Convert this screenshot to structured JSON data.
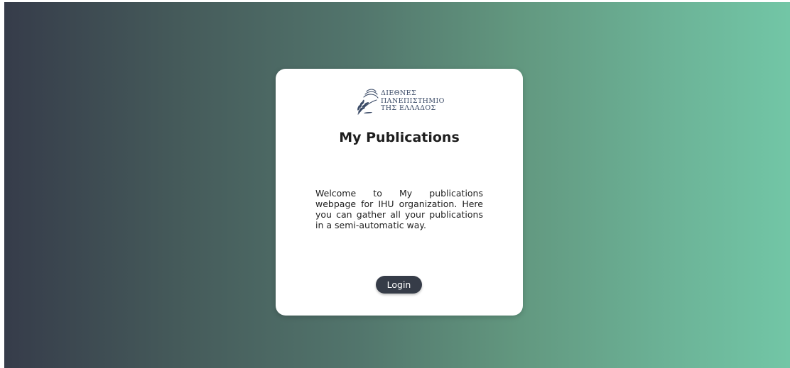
{
  "logo": {
    "icon": "olive-branch-wave-logo",
    "lines": [
      "ΔΙΕΘΝΕΣ",
      "ΠΑΝΕΠΙΣΤΗΜΙΟ",
      "ΤΗΣ ΕΛΛΑΔΟΣ"
    ]
  },
  "card": {
    "title": "My Publications",
    "welcome": "Welcome to My publications webpage for IHU organization. Here you can gather all your publications in a semi-automatic way.",
    "login_label": "Login"
  },
  "colors": {
    "gradient_start": "#363c4a",
    "gradient_end": "#72c6a6",
    "button": "#363c48",
    "logo_text": "#3a4a66"
  }
}
